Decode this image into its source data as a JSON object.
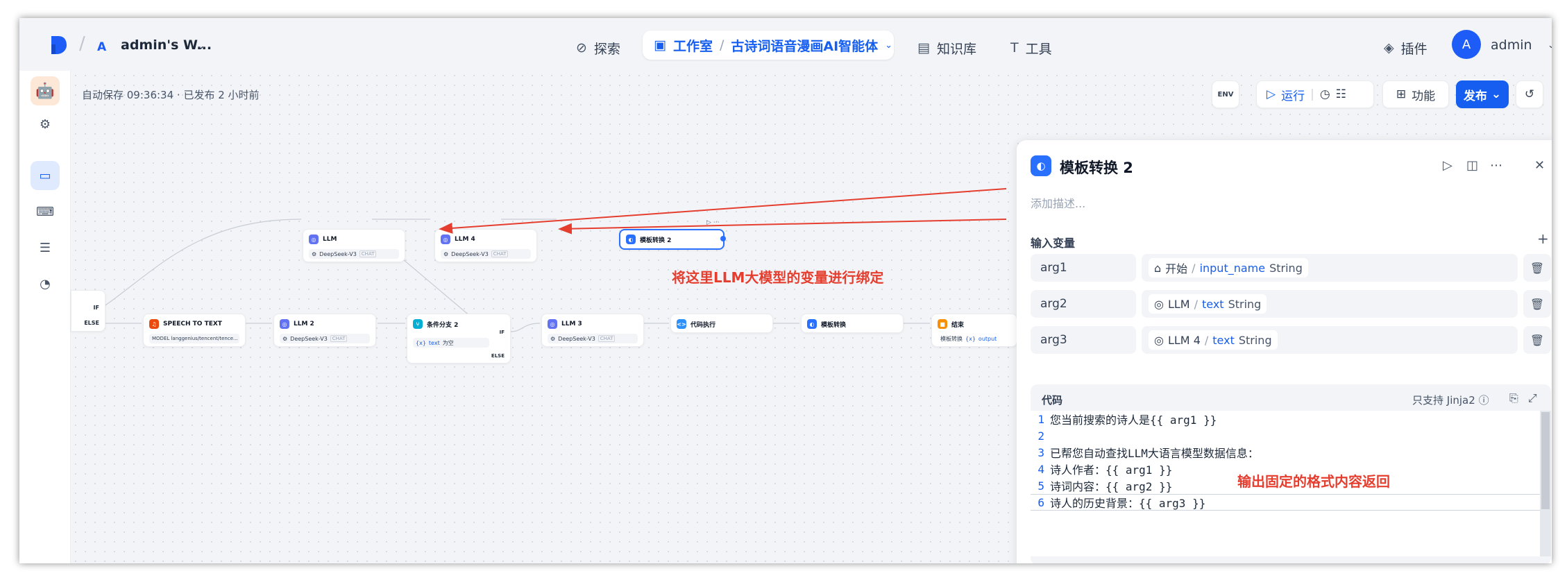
{
  "topbar": {
    "workspace_badge": "A",
    "workspace_name": "admin's W...",
    "nav": {
      "explore": "探索",
      "studio": "工作室",
      "app_name": "古诗词语音漫画AI智能体",
      "knowledge": "知识库",
      "tools": "工具",
      "plugins": "插件"
    },
    "user_initial": "A",
    "user_name": "admin"
  },
  "canvas": {
    "save_status": "自动保存 09:36:34 · 已发布 2 小时前",
    "toolbar": {
      "env": "ENV",
      "run": "运行",
      "features": "功能",
      "publish": "发布"
    },
    "annotation_bind": "将这里LLM大模型的变量进行绑定",
    "annotation_output": "输出固定的格式内容返回",
    "nodes": {
      "llm": {
        "title": "LLM",
        "model": "DeepSeek-V3",
        "mode": "CHAT"
      },
      "llm4": {
        "title": "LLM 4",
        "model": "DeepSeek-V3",
        "mode": "CHAT"
      },
      "template2": {
        "title": "模板转换 2"
      },
      "if_label": "IF",
      "else_label": "ELSE",
      "speech": {
        "title": "SPEECH TO TEXT",
        "sub": "MODEL langgenius/tencent/tence..."
      },
      "llm2": {
        "title": "LLM 2",
        "model": "DeepSeek-V3",
        "mode": "CHAT"
      },
      "branch2": {
        "title": "条件分支 2",
        "if": "IF",
        "cond_var": "text",
        "cond_op": "为空",
        "else": "ELSE"
      },
      "llm3": {
        "title": "LLM 3",
        "model": "DeepSeek-V3",
        "mode": "CHAT"
      },
      "code": {
        "title": "代码执行"
      },
      "template": {
        "title": "模板转换"
      },
      "end": {
        "title": "结束",
        "out_src": "模板转换",
        "out_var": "output"
      }
    }
  },
  "panel": {
    "title": "模板转换 2",
    "description_placeholder": "添加描述...",
    "inputs_label": "输入变量",
    "variables": [
      {
        "name": "arg1",
        "node": "开始",
        "var": "input_name",
        "type": "String"
      },
      {
        "name": "arg2",
        "node": "LLM",
        "var": "text",
        "type": "String"
      },
      {
        "name": "arg3",
        "node": "LLM 4",
        "var": "text",
        "type": "String"
      }
    ],
    "code_label": "代码",
    "code_support": "只支持 Jinja2",
    "code_lines": [
      {
        "n": "1",
        "text": "您当前搜索的诗人是{{ arg1 }}"
      },
      {
        "n": "2",
        "text": ""
      },
      {
        "n": "3",
        "text": "已帮您自动查找LLM大语言模型数据信息："
      },
      {
        "n": "4",
        "text": "诗人作者：{{ arg1 }}"
      },
      {
        "n": "5",
        "text": "诗词内容：{{ arg2 }}"
      },
      {
        "n": "6",
        "text": "诗人的历史背景：{{ arg3 }}"
      }
    ]
  },
  "colors": {
    "accent": "#155eef",
    "annotation": "#e53e2f"
  }
}
